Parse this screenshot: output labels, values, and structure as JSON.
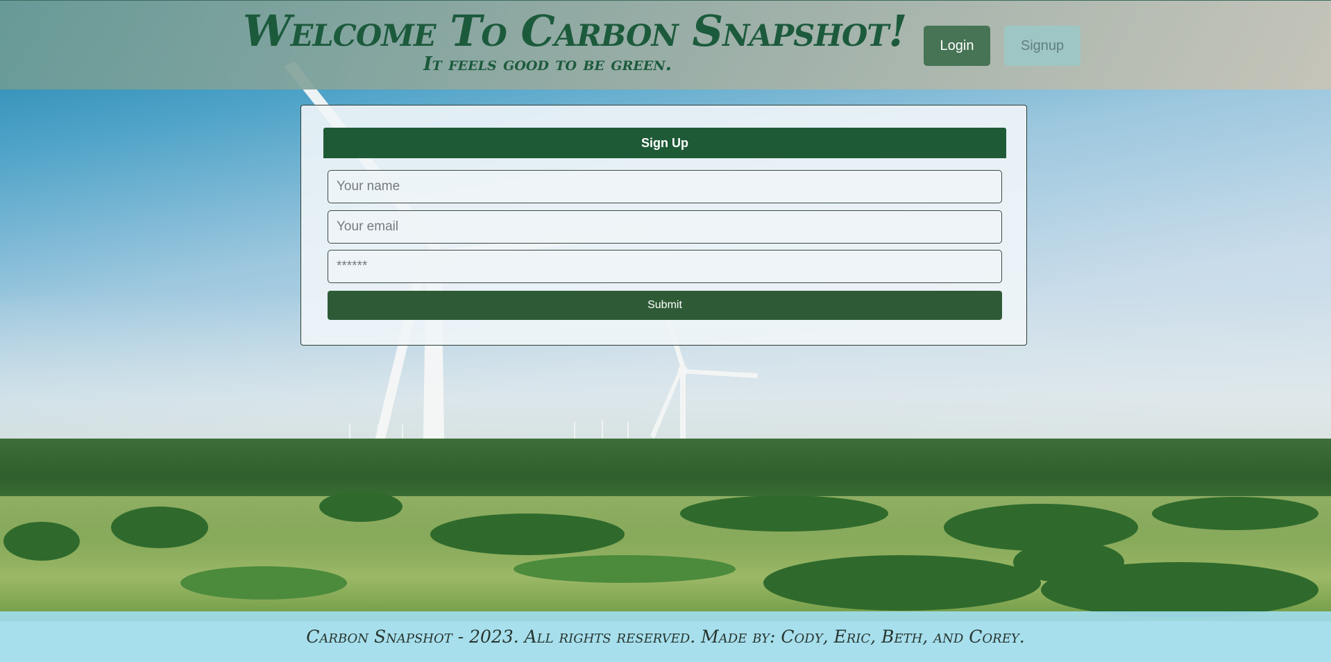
{
  "header": {
    "title": "Welcome To Carbon Snapshot!",
    "tagline": "It feels good to be green.",
    "login_label": "Login",
    "signup_label": "Signup"
  },
  "signup_form": {
    "heading": "Sign Up",
    "name_placeholder": "Your name",
    "email_placeholder": "Your email",
    "password_placeholder": "******",
    "submit_label": "Submit"
  },
  "footer": {
    "text": "Carbon Snapshot - 2023. All rights reserved. Made by: Cody, Eric, Beth, and Corey."
  },
  "colors": {
    "brand_green": "#1f5a36",
    "button_green": "#477455",
    "signup_button": "#9ec6c4",
    "footer_bg": "#a0dceb"
  },
  "background": {
    "scene": "wind-turbines-over-green-fields"
  }
}
